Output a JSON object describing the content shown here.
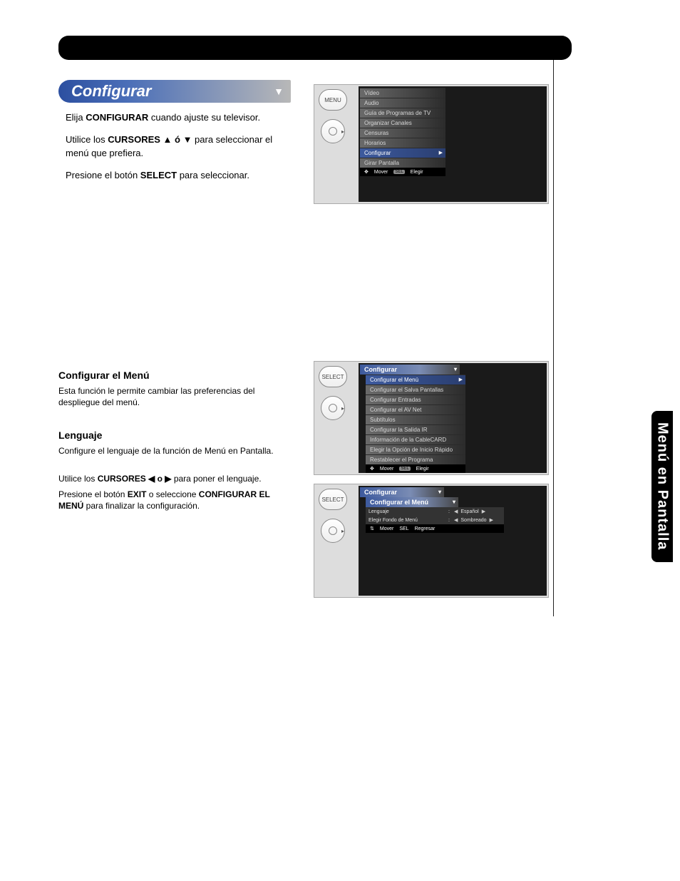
{
  "sidetab": "Menú en Pantalla",
  "section1": {
    "title": "Configurar",
    "intro_prefix": "Elija ",
    "intro_bold": "CONFIGURAR",
    "intro_suffix": " cuando ajuste su televisor.",
    "step1_a": "Utilice los ",
    "step1_bold": "CURSORES ▲ ó ▼",
    "step1_b": " para seleccionar el menú que prefiera.",
    "step2_a": "Presione el botón ",
    "step2_bold": "SELECT",
    "step2_b": " para seleccionar."
  },
  "section2": {
    "h1": "Configurar el Menú",
    "p1": "Esta función le permite cambiar las preferencias del despliegue del menú.",
    "h2": "Lenguaje",
    "p2": "Configure el lenguaje de la función de Menú en Pantalla.",
    "step1_a": "Utilice los ",
    "step1_bold": "CURSORES ◀ o ▶",
    "step1_b": " para poner el lenguaje.",
    "step2_a": "Presione el botón ",
    "step2_exit": "EXIT",
    "step2_b": " o seleccione ",
    "step2_conf": "CONFIGURAR EL MENÚ",
    "step2_c": " para finalizar la configuración."
  },
  "tv1": {
    "btn1": "MENU",
    "items": [
      "Vídeo",
      "Audio",
      "Guía de Programas de TV",
      "Organizar Canales",
      "Censuras",
      "Horarios",
      "Configurar",
      "Girar Pantalla"
    ],
    "selected": 6,
    "mover": "Mover",
    "sel": "SEL",
    "elegir": "Elegir"
  },
  "tv2": {
    "btn1": "SELECT",
    "head": "Configurar",
    "items": [
      "Configurar el Menú",
      "Configurar el Salva Pantallas",
      "Configurar Entradas",
      "Configurar el AV Net",
      "Subtítulos",
      "Configurar la Salida IR",
      "Información de la CableCARD",
      "Elegir la Opción de Inicio Rápido",
      "Restablecer el Programa"
    ],
    "selected": 0,
    "mover": "Mover",
    "sel": "SEL",
    "elegir": "Elegir"
  },
  "tv3": {
    "btn1": "SELECT",
    "head": "Configurar",
    "head2": "Configurar el Menú",
    "opt1_label": "Lenguaje",
    "opt1_value": "Español",
    "opt2_label": "Elegir Fondo de Menú",
    "opt2_value": "Sombreado",
    "mover": "Mover",
    "sel": "SEL",
    "regresar": "Regresar"
  }
}
